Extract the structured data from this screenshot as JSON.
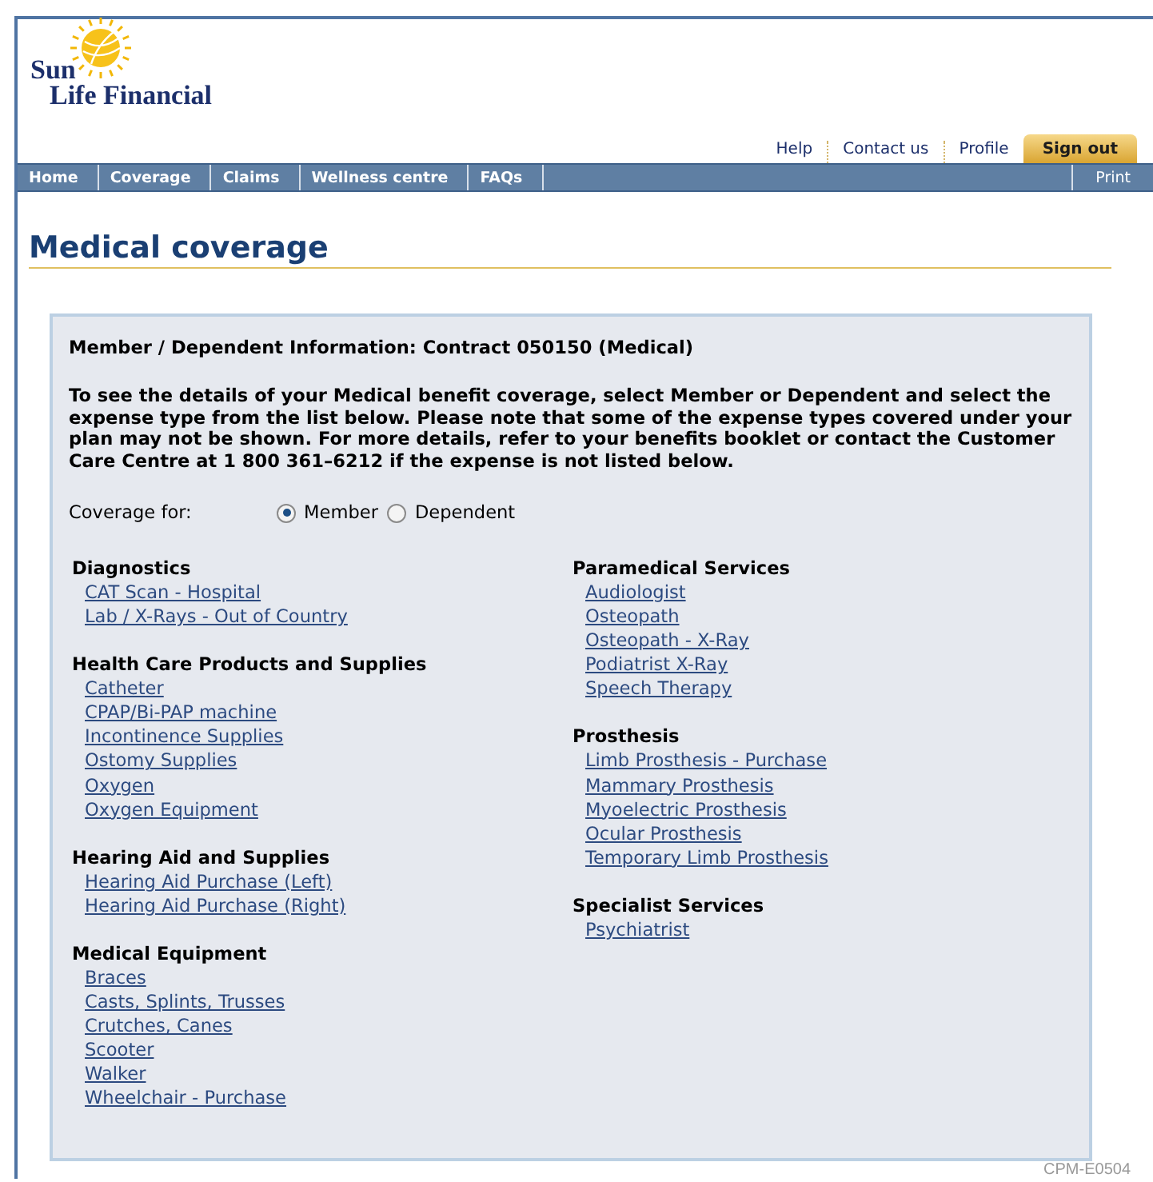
{
  "logo": {
    "line_1": "Sun",
    "line_2": "Life Financial"
  },
  "top_links": [
    {
      "label": "Help",
      "kind": "link"
    },
    {
      "label": "Contact us",
      "kind": "link"
    },
    {
      "label": "Profile",
      "kind": "link"
    },
    {
      "label": "Sign out",
      "kind": "button"
    }
  ],
  "nav": {
    "items": [
      "Home",
      "Coverage",
      "Claims",
      "Wellness centre",
      "FAQs"
    ],
    "print": "Print"
  },
  "page_title": "Medical coverage",
  "panel": {
    "heading": "Member / Dependent Information: Contract 050150   (Medical)",
    "intro": "To see the details of your Medical benefit coverage, select Member or Dependent and select the expense type from the list below. Please note that some of the expense types covered under your plan may not be shown. For more details, refer to your benefits booklet or contact the Customer Care Centre at 1 800 361–6212 if the expense is not listed below.",
    "coverage_label": "Coverage for:",
    "coverage_options": [
      {
        "label": "Member",
        "selected": true
      },
      {
        "label": "Dependent",
        "selected": false
      }
    ],
    "columns": [
      [
        {
          "title": "Diagnostics",
          "links": [
            "CAT Scan - Hospital",
            "Lab / X-Rays - Out of Country"
          ]
        },
        {
          "title": "Health Care Products and Supplies",
          "links": [
            "Catheter",
            "CPAP/Bi-PAP machine",
            "Incontinence Supplies",
            "Ostomy Supplies",
            "Oxygen",
            "Oxygen Equipment"
          ]
        },
        {
          "title": "Hearing Aid and Supplies",
          "links": [
            "Hearing Aid Purchase (Left)",
            "Hearing Aid Purchase (Right)"
          ]
        },
        {
          "title": "Medical Equipment",
          "links": [
            "Braces",
            "Casts, Splints, Trusses",
            "Crutches, Canes",
            "Scooter",
            "Walker",
            "Wheelchair - Purchase"
          ]
        }
      ],
      [
        {
          "title": "Paramedical Services",
          "links": [
            "Audiologist",
            "Osteopath",
            "Osteopath - X-Ray",
            "Podiatrist X-Ray",
            "Speech Therapy"
          ]
        },
        {
          "title": "Prosthesis",
          "links": [
            "Limb Prosthesis - Purchase",
            "Mammary Prosthesis",
            "Myoelectric Prosthesis",
            "Ocular Prosthesis",
            "Temporary Limb Prosthesis"
          ]
        },
        {
          "title": "Specialist Services",
          "links": [
            "Psychiatrist"
          ]
        }
      ]
    ]
  },
  "page_code": "CPM-E0504"
}
